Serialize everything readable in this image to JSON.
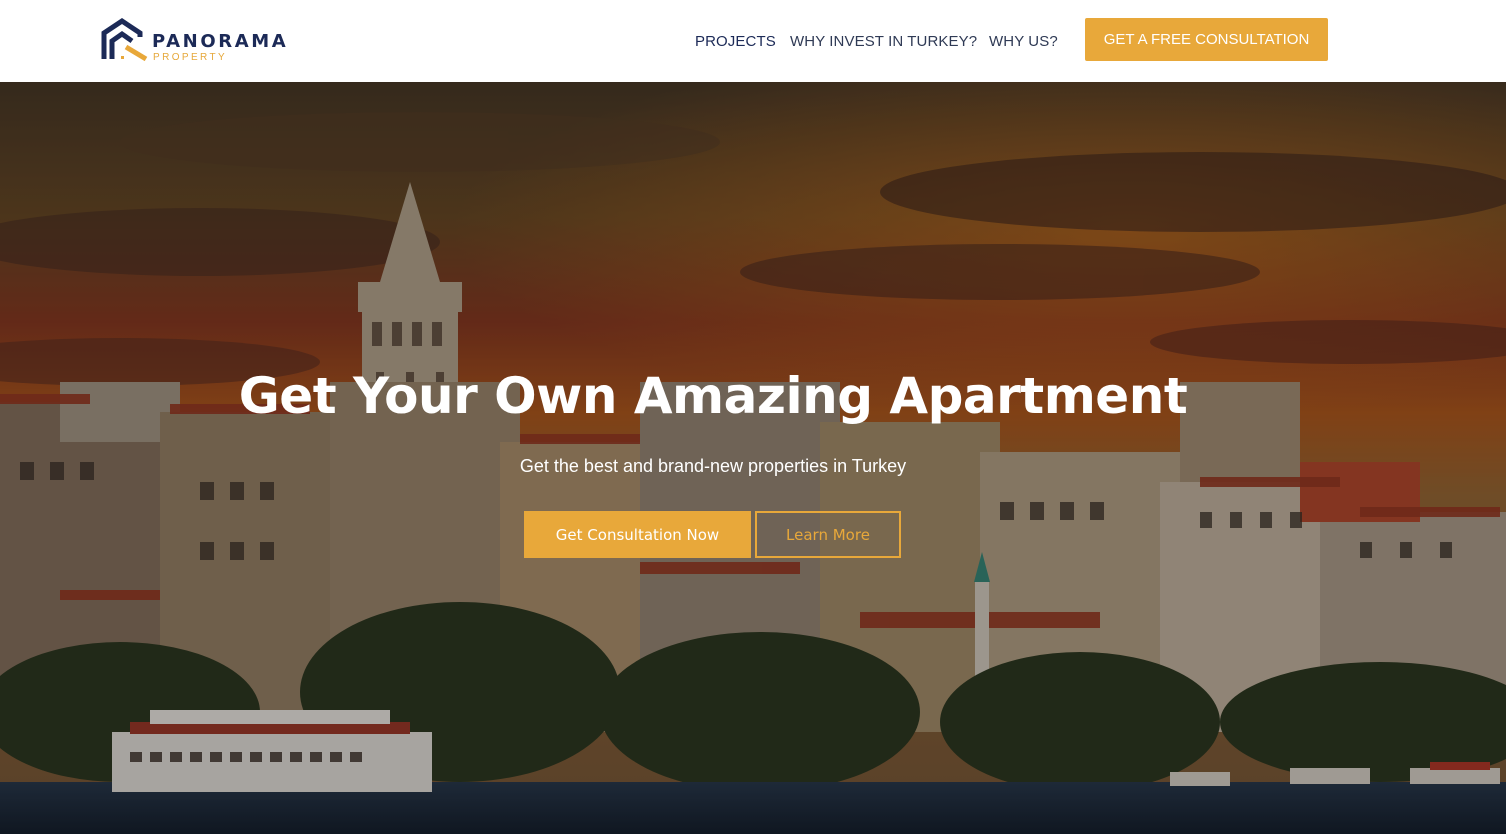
{
  "brand": {
    "name": "PANORAMA",
    "tagline": "PROPERTY",
    "logo_icon": "house-roof-icon",
    "colors": {
      "navy": "#1c2a57",
      "gold": "#e8a83a"
    }
  },
  "nav": {
    "items": [
      {
        "label": "PROJECTS"
      },
      {
        "label": "WHY INVEST IN TURKEY?"
      },
      {
        "label": "WHY US?"
      }
    ],
    "cta_label": "GET A FREE CONSULTATION"
  },
  "hero": {
    "title": "Get Your Own Amazing Apartment",
    "subtitle": "Get the best and brand-new properties in Turkey",
    "primary_button": "Get Consultation Now",
    "secondary_button": "Learn More",
    "background": "istanbul-sunset-cityscape-with-galata-tower-and-ferry"
  }
}
